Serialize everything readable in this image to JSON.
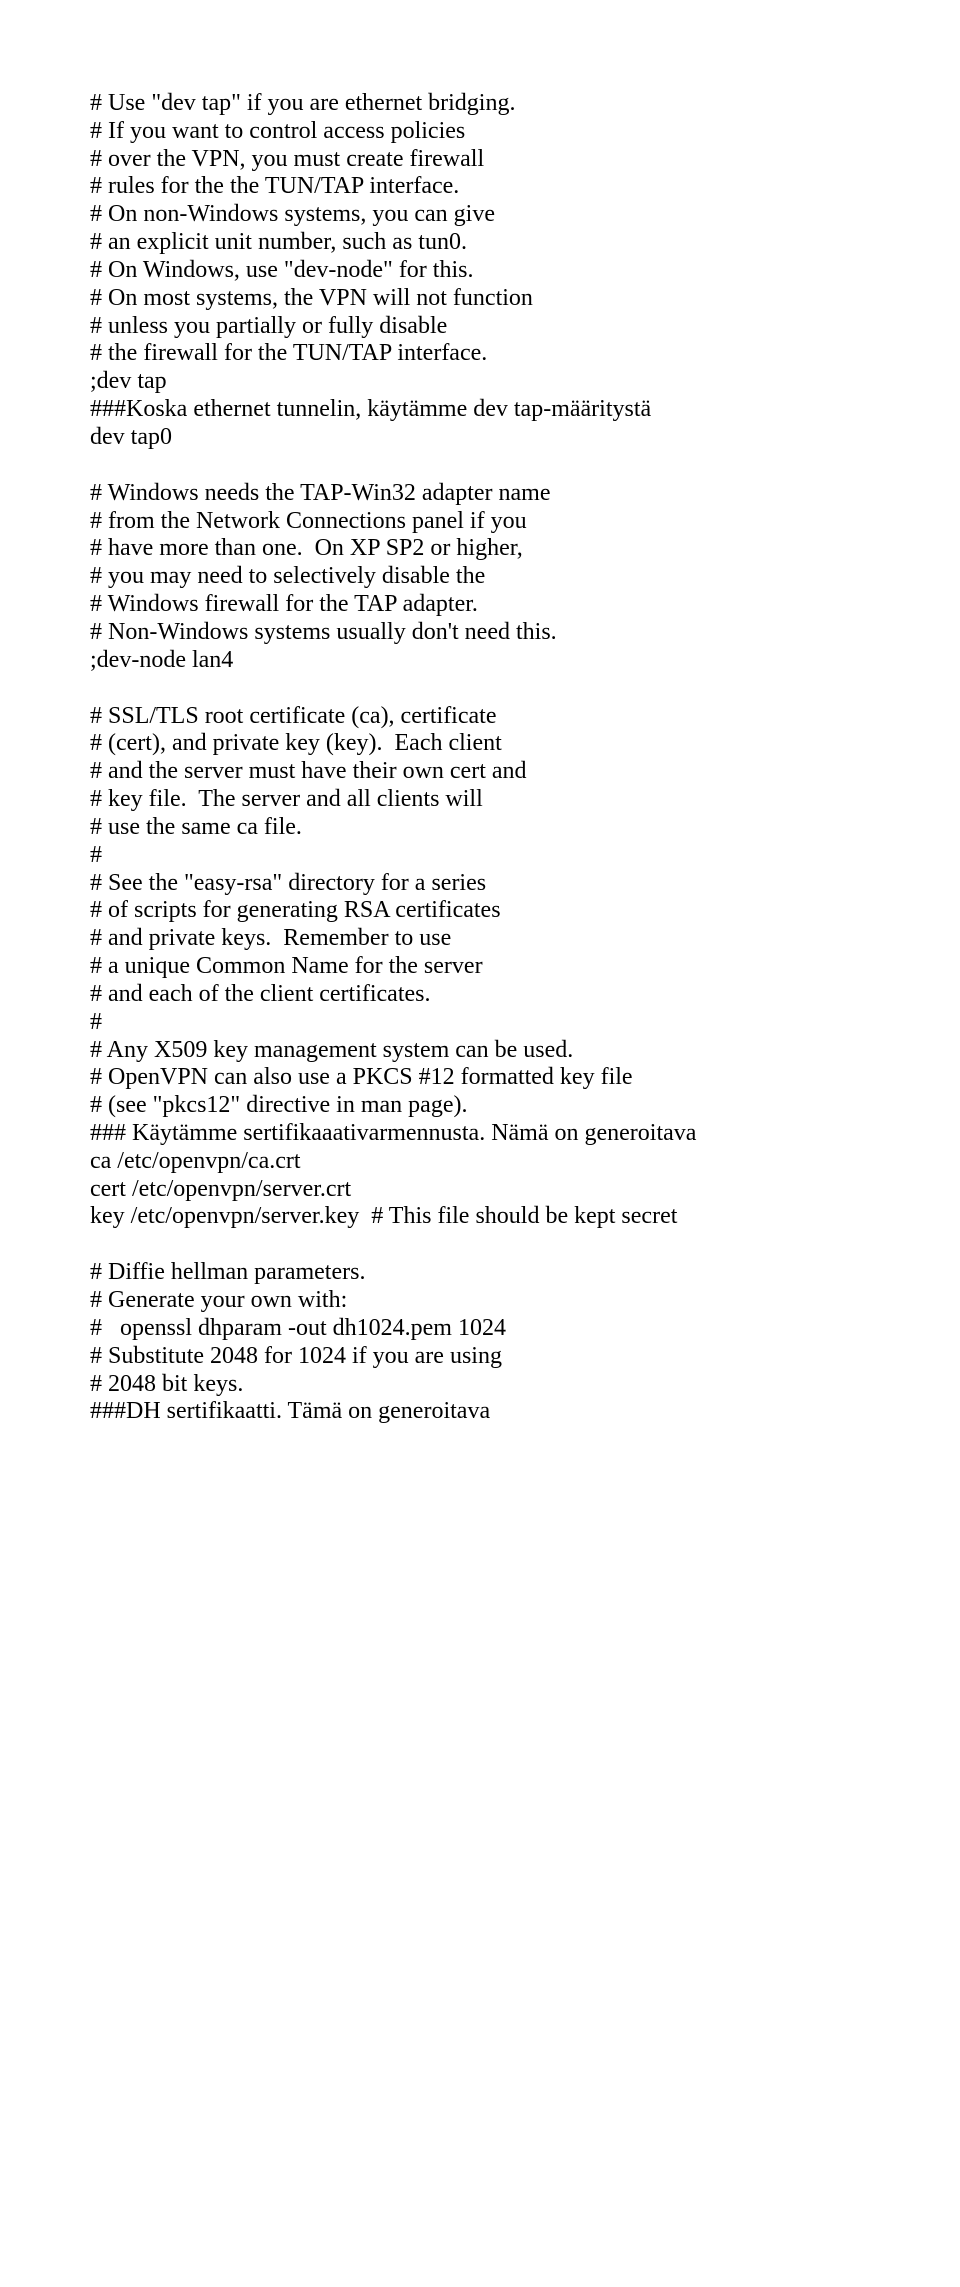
{
  "lines": [
    "# Use \"dev tap\" if you are ethernet bridging.",
    "# If you want to control access policies",
    "# over the VPN, you must create firewall",
    "# rules for the the TUN/TAP interface.",
    "# On non-Windows systems, you can give",
    "# an explicit unit number, such as tun0.",
    "# On Windows, use \"dev-node\" for this.",
    "# On most systems, the VPN will not function",
    "# unless you partially or fully disable",
    "# the firewall for the TUN/TAP interface.",
    ";dev tap",
    "###Koska ethernet tunnelin, käytämme dev tap-määritystä",
    "dev tap0",
    "",
    "# Windows needs the TAP-Win32 adapter name",
    "# from the Network Connections panel if you",
    "# have more than one.  On XP SP2 or higher,",
    "# you may need to selectively disable the",
    "# Windows firewall for the TAP adapter.",
    "# Non-Windows systems usually don't need this.",
    ";dev-node lan4",
    "",
    "# SSL/TLS root certificate (ca), certificate",
    "# (cert), and private key (key).  Each client",
    "# and the server must have their own cert and",
    "# key file.  The server and all clients will",
    "# use the same ca file.",
    "#",
    "# See the \"easy-rsa\" directory for a series",
    "# of scripts for generating RSA certificates",
    "# and private keys.  Remember to use",
    "# a unique Common Name for the server",
    "# and each of the client certificates.",
    "#",
    "# Any X509 key management system can be used.",
    "# OpenVPN can also use a PKCS #12 formatted key file",
    "# (see \"pkcs12\" directive in man page).",
    "### Käytämme sertifikaaativarmennusta. Nämä on generoitava",
    "ca /etc/openvpn/ca.crt",
    "cert /etc/openvpn/server.crt",
    "key /etc/openvpn/server.key  # This file should be kept secret",
    "",
    "# Diffie hellman parameters.",
    "# Generate your own with:",
    "#   openssl dhparam -out dh1024.pem 1024",
    "# Substitute 2048 for 1024 if you are using",
    "# 2048 bit keys.",
    "###DH sertifikaatti. Tämä on generoitava"
  ]
}
